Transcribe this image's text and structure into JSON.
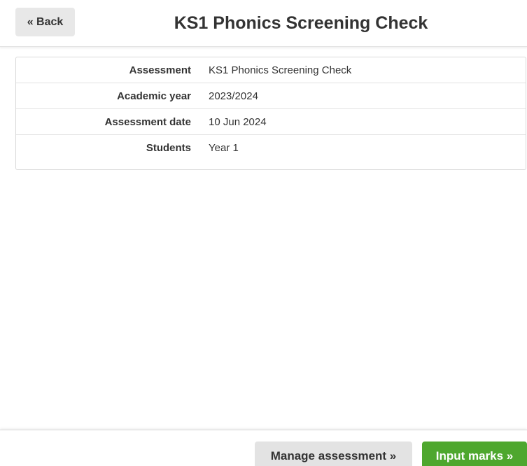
{
  "header": {
    "back_label": "« Back",
    "title": "KS1 Phonics Screening Check"
  },
  "details": {
    "rows": [
      {
        "label": "Assessment",
        "value": "KS1 Phonics Screening Check"
      },
      {
        "label": "Academic year",
        "value": "2023/2024"
      },
      {
        "label": "Assessment date",
        "value": "10 Jun 2024"
      },
      {
        "label": "Students",
        "value": "Year 1"
      }
    ]
  },
  "footer": {
    "manage_label": "Manage assessment »",
    "input_label": "Input marks »"
  },
  "colors": {
    "primary_action": "#4ea72e",
    "secondary_action": "#e3e3e3"
  }
}
